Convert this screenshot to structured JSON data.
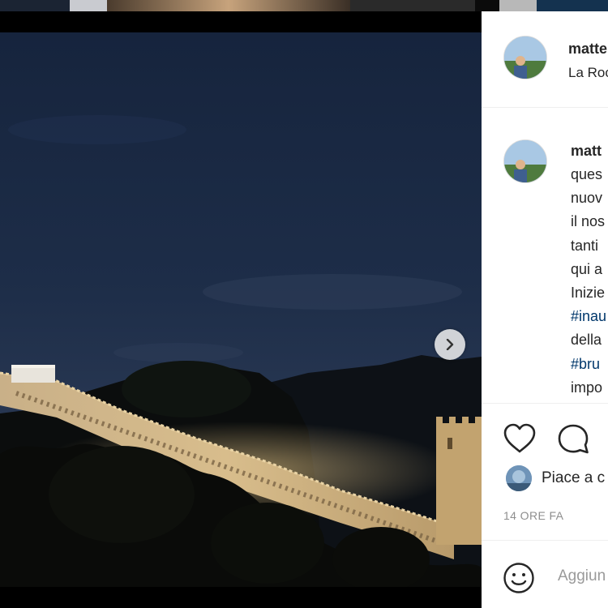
{
  "post": {
    "username": "matte",
    "location": "La Roc",
    "caption_username": "matt",
    "caption_lines": [
      {
        "text": "ques",
        "hashtag": false
      },
      {
        "text": "nuov",
        "hashtag": false
      },
      {
        "text": "il nos",
        "hashtag": false
      },
      {
        "text": "tanti",
        "hashtag": false
      },
      {
        "text": "qui a",
        "hashtag": false
      },
      {
        "text": "Inizie",
        "hashtag": false
      },
      {
        "text": "#inau",
        "hashtag": true
      },
      {
        "text": "della",
        "hashtag": false
      },
      {
        "text": "#bru",
        "hashtag": true
      },
      {
        "text": "impo",
        "hashtag": false
      }
    ],
    "likes_text": "Piace a c",
    "time_ago": "14 ORE FA",
    "comment_placeholder": "Aggiun",
    "carousel": {
      "total": 2,
      "active": 0
    }
  },
  "icons": {
    "like": "heart-icon",
    "comment": "comment-bubble-icon",
    "emoji": "smiley-icon",
    "next": "chevron-right-icon"
  },
  "colors": {
    "hashtag": "#00376b",
    "text": "#262626",
    "muted": "#8e8e8e",
    "divider": "#efefef"
  }
}
